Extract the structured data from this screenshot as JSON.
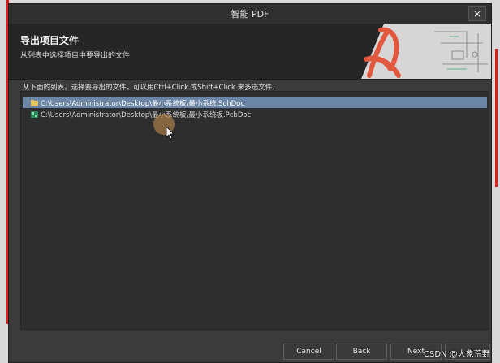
{
  "dialog": {
    "title": "智能 PDF",
    "close_glyph": "×"
  },
  "header": {
    "title": "导出项目文件",
    "subtitle": "从列表中选择项目中要导出的文件"
  },
  "instruction": "从下面的列表，选择要导出的文件。可以用Ctrl+Click 或Shift+Click 来多选文件.",
  "files": [
    {
      "path": "C:\\Users\\Administrator\\Desktop\\最小系统板\\最小系统.SchDoc",
      "icon": "schematic-doc-icon",
      "selected": true
    },
    {
      "path": "C:\\Users\\Administrator\\Desktop\\最小系统板\\最小系统板.PcbDoc",
      "icon": "pcb-doc-icon",
      "selected": false
    }
  ],
  "buttons": {
    "cancel": "Cancel",
    "back": "Back",
    "next": "Next"
  },
  "watermark": "CSDN @大象荒野",
  "colors": {
    "dialog_bg": "#3b3b3b",
    "header_bg": "#262626",
    "selection": "#6b85a6",
    "accent_red": "#e21b1b"
  }
}
